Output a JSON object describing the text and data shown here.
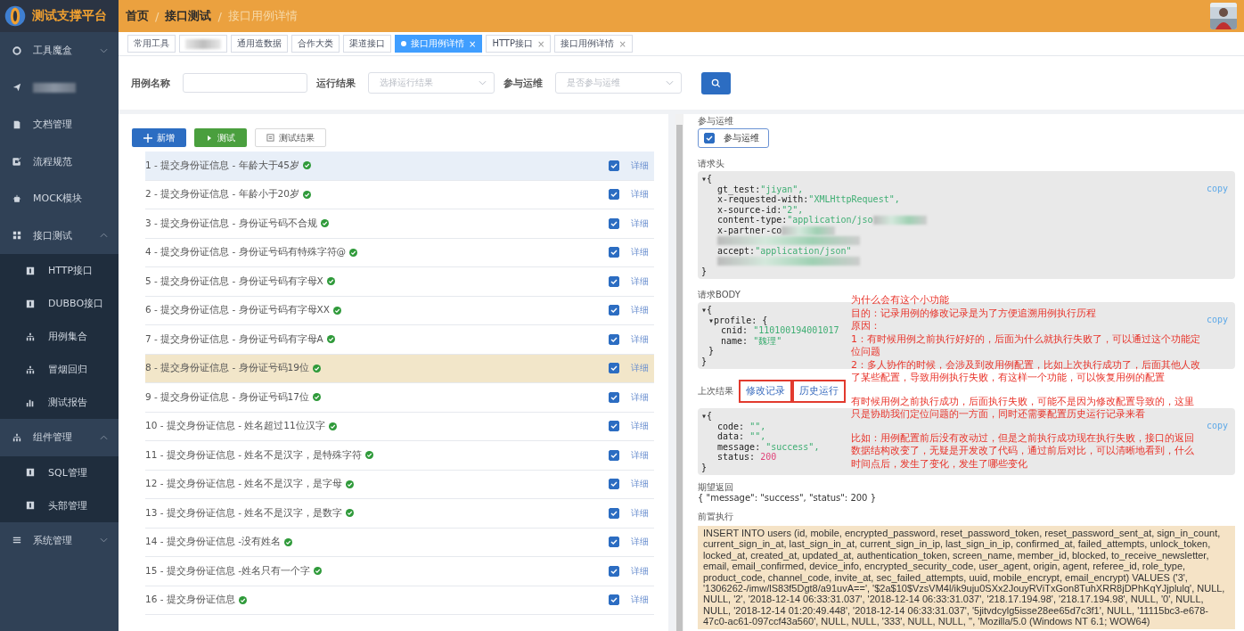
{
  "app": {
    "title": "测试支撑平台"
  },
  "breadcrumb": {
    "separator": "/",
    "items": [
      {
        "label": "首页",
        "current": false
      },
      {
        "label": "接口测试",
        "current": false
      },
      {
        "label": "接口用例详情",
        "current": true
      }
    ]
  },
  "sidebar": {
    "items": [
      {
        "label": "工具魔盒",
        "expanded": false,
        "has_children": true
      },
      {
        "redacted": true
      },
      {
        "label": "文档管理"
      },
      {
        "label": "流程规范"
      },
      {
        "label": "MOCK模块"
      },
      {
        "label": "接口测试",
        "expanded": true,
        "has_children": true,
        "children": [
          {
            "label": "HTTP接口"
          },
          {
            "label": "DUBBO接口"
          },
          {
            "label": "用例集合"
          },
          {
            "label": "冒烟回归"
          },
          {
            "label": "测试报告"
          }
        ]
      },
      {
        "label": "组件管理",
        "expanded": true,
        "has_children": true,
        "children": [
          {
            "label": "SQL管理"
          },
          {
            "label": "头部管理"
          }
        ]
      },
      {
        "label": "系统管理",
        "expanded": false,
        "has_children": true
      }
    ]
  },
  "tabs": [
    {
      "label": "常用工具",
      "selected": false
    },
    {
      "redacted": true,
      "selected": false
    },
    {
      "label": "通用造数据",
      "selected": false
    },
    {
      "label": "合作大类",
      "selected": false
    },
    {
      "label": "渠道接口",
      "selected": false
    },
    {
      "label": "接口用例详情",
      "selected": true,
      "close": "×"
    },
    {
      "label": "HTTP接口",
      "selected": false,
      "close": "×"
    },
    {
      "label": "接口用例详情",
      "selected": false,
      "close": "×"
    }
  ],
  "filters": [
    {
      "kind": "input",
      "label": "用例名称"
    },
    {
      "kind": "select",
      "label": "运行结果",
      "placeholder": "选择运行结果"
    },
    {
      "kind": "select",
      "label": "参与运维",
      "placeholder": "是否参与运维"
    }
  ],
  "toolbar": [
    {
      "kind": "add",
      "label": "新增"
    },
    {
      "kind": "run",
      "label": "测试"
    },
    {
      "kind": "result",
      "label": "测试结果"
    }
  ],
  "rows": [
    {
      "name": "1 - 提交身份证信息 - 年龄大于45岁",
      "passed": true,
      "checked": true,
      "selected": true,
      "highlighted": false,
      "link": "详细"
    },
    {
      "name": "2 - 提交身份证信息 - 年龄小于20岁",
      "passed": true,
      "checked": true,
      "selected": false,
      "highlighted": false,
      "link": "详细"
    },
    {
      "name": "3 - 提交身份证信息 - 身份证号码不合规",
      "passed": true,
      "checked": true,
      "selected": false,
      "highlighted": false,
      "link": "详细"
    },
    {
      "name": "4 - 提交身份证信息 - 身份证号码有特殊字符@",
      "passed": true,
      "checked": true,
      "selected": false,
      "highlighted": false,
      "link": "详细"
    },
    {
      "name": "5 - 提交身份证信息 - 身份证号码有字母X",
      "passed": true,
      "checked": true,
      "selected": false,
      "highlighted": false,
      "link": "详细"
    },
    {
      "name": "6 - 提交身份证信息 - 身份证号码有字母XX",
      "passed": true,
      "checked": true,
      "selected": false,
      "highlighted": false,
      "link": "详细"
    },
    {
      "name": "7 - 提交身份证信息 - 身份证号码有字母A",
      "passed": true,
      "checked": true,
      "selected": false,
      "highlighted": false,
      "link": "详细"
    },
    {
      "name": "8 - 提交身份证信息 - 身份证号码19位",
      "passed": true,
      "checked": true,
      "selected": false,
      "highlighted": true,
      "link": "详细"
    },
    {
      "name": "9 - 提交身份证信息 - 身份证号码17位",
      "passed": true,
      "checked": true,
      "selected": false,
      "highlighted": false,
      "link": "详细"
    },
    {
      "name": "10 - 提交身份证信息 - 姓名超过11位汉字",
      "passed": true,
      "checked": true,
      "selected": false,
      "highlighted": false,
      "link": "详细"
    },
    {
      "name": "11 - 提交身份证信息 - 姓名不是汉字，是特殊字符",
      "passed": true,
      "checked": true,
      "selected": false,
      "highlighted": false,
      "link": "详细"
    },
    {
      "name": "12 - 提交身份证信息 - 姓名不是汉字，是字母",
      "passed": true,
      "checked": true,
      "selected": false,
      "highlighted": false,
      "link": "详细"
    },
    {
      "name": "13 - 提交身份证信息 - 姓名不是汉字，是数字",
      "passed": true,
      "checked": true,
      "selected": false,
      "highlighted": false,
      "link": "详细"
    },
    {
      "name": "14 - 提交身份证信息 -没有姓名",
      "passed": true,
      "checked": true,
      "selected": false,
      "highlighted": false,
      "link": "详细"
    },
    {
      "name": "15 - 提交身份证信息 -姓名只有一个字",
      "passed": true,
      "checked": true,
      "selected": false,
      "highlighted": false,
      "link": "详细"
    },
    {
      "name": "16 - 提交身份证信息",
      "passed": true,
      "checked": true,
      "selected": false,
      "highlighted": false,
      "link": "详细"
    }
  ],
  "detail": {
    "ops_label": "参与运维",
    "ops_checkbox": {
      "label": "参与运维",
      "checked": true
    },
    "headers": {
      "label": "请求头",
      "copy": "copy",
      "toggle": "▾",
      "open": "{",
      "close": "}",
      "entries": [
        {
          "kind": "string",
          "key": "gt_test:",
          "value": "\"jiyan\","
        },
        {
          "kind": "string",
          "key": "x-requested-with:",
          "value": "\"XMLHttpRequest\","
        },
        {
          "kind": "string",
          "key": "x-source-id:",
          "value": "\"2\","
        },
        {
          "kind": "string",
          "key": "content-type:",
          "value": "\"application/jso",
          "redacted_after": true
        },
        {
          "kind": "key",
          "key": "x-partner-co",
          "redacted_after": true
        },
        {
          "kind": "redacted"
        },
        {
          "kind": "string",
          "key": "accept:",
          "value": "\"application/json\""
        },
        {
          "kind": "redacted"
        }
      ]
    },
    "body": {
      "label": "请求BODY",
      "copy": "copy",
      "toggle": "▾",
      "open": "{",
      "close": "}",
      "entries": [
        {
          "kind": "object",
          "key": "profile:",
          "toggle": "▾",
          "open": "{",
          "close": "}",
          "children": [
            {
              "kind": "string",
              "key": "cnid:",
              "value": "\"110100194001017"
            },
            {
              "kind": "string",
              "key": "name:",
              "value": "\"魏理\""
            }
          ]
        }
      ]
    },
    "last_result": {
      "label": "上次结果",
      "tabs": [
        {
          "label": "修改记录"
        },
        {
          "label": "历史运行"
        }
      ]
    },
    "result": {
      "copy": "copy",
      "toggle": "▾",
      "open": "{",
      "close": "}",
      "entries": [
        {
          "kind": "string",
          "key": "code:",
          "value": "\"\","
        },
        {
          "kind": "string",
          "key": "data:",
          "value": "\"\","
        },
        {
          "kind": "string",
          "key": "message:",
          "value": "\"success\","
        },
        {
          "kind": "number",
          "key": "status:",
          "value": "200"
        }
      ]
    },
    "expected": {
      "label": "期望返回",
      "value": "{ \"message\": \"success\", \"status\": 200 }"
    },
    "pre_exec": {
      "label": "前置执行",
      "value": "INSERT INTO users (id, mobile, encrypted_password, reset_password_token, reset_password_sent_at, sign_in_count, current_sign_in_at, last_sign_in_at, current_sign_in_ip, last_sign_in_ip, confirmed_at, failed_attempts, unlock_token, locked_at, created_at, updated_at, authentication_token, screen_name, member_id, blocked, to_receive_newsletter, email, email_confirmed, device_info, encrypted_security_code, user_agent, origin, agent, referee_id, role_type, product_code, channel_code, invite_at, sec_failed_attempts, uuid, mobile_encrypt, email_encrypt) VALUES ('3', '1306262-/imw/lS83f5Dgt8/a91uvA==', '$2a$10$VzsVM4l/ik9uju0SXx2JouyRViTxGon8TuhXRR8jDPhKqYJjplulq', NULL, NULL, '2', '2018-12-14 06:33:31.037', '2018-12-14 06:33:31.037', '218.17.194.98', '218.17.194.98', NULL, '0', NULL, NULL, '2018-12-14 01:20:49.448', '2018-12-14 06:33:31.037', '5jitvdcylg5isse28ee65d7c3f1', NULL, '11115bc3-e678-47c0-ac61-097ccf43a560', NULL, NULL, '333', NULL, NULL, '', 'Mozilla/5.0 (Windows NT 6.1; WOW64)"
    }
  },
  "annotation": {
    "groups": [
      [
        "为什么会有这个小功能",
        "目的：记录用例的修改记录是为了方便追溯用例执行历程",
        "原因：",
        "1：有时候用例之前执行好好的，后面为什么就执行失败了，可以通过这个功能定位问题",
        "2：多人协作的时候，会涉及到改用例配置，比如上次执行成功了，后面其他人改了某些配置，导致用例执行失败，有这样一个功能，可以恢复用例的配置"
      ],
      [
        "有时候用例之前执行成功，后面执行失败，可能不是因为修改配置导致的，这里只是协助我们定位问题的一方面，同时还需要配置历史运行记录来看"
      ],
      [
        "比如：用例配置前后没有改动过，但是之前执行成功现在执行失败，接口的返回数据结构改变了，无疑是开发改了代码，通过前后对比，可以清晰地看到，什么时间点后，发生了变化，发生了哪些变化"
      ]
    ]
  }
}
